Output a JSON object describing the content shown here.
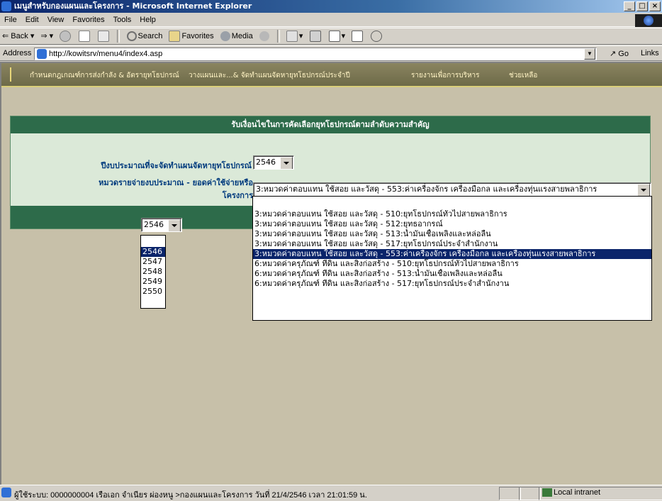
{
  "window": {
    "title": "เมนูสำหรับกองแผนและโครงการ - Microsoft Internet Explorer",
    "min": "_",
    "max": "□",
    "close": "×"
  },
  "menu": [
    "File",
    "Edit",
    "View",
    "Favorites",
    "Tools",
    "Help"
  ],
  "toolbar": {
    "back": "Back",
    "search": "Search",
    "favorites": "Favorites",
    "media": "Media"
  },
  "address": {
    "label": "Address",
    "url": "http://kowitsrv/menu4/index4.asp",
    "go": "Go",
    "links": "Links"
  },
  "nav": [
    "กำหนดกฎเกณฑ์การส่งกำลัง & อัตรายุทโธปกรณ์",
    "วางแผนและ...& จัดทำแผนจัดหายุทโธปกรณ์ประจำปี",
    "รายงานเพื่อการบริหาร",
    "ช่วยเหลือ"
  ],
  "form": {
    "heading": "รับเงื่อนไขในการคัดเลือกยุทโธปกรณ์ตามลำดับความสำคัญ",
    "year_label": "ปีงบประมาณที่จะจัดทำแผนจัดหายุทโธปกรณ์",
    "year_value": "2546",
    "category_label_1": "หมวดรายจ่ายงบประมาณ - ยอดค่าใช้จ่ายหรือ",
    "category_label_2": "โครงการ",
    "category_value": "3:หมวดค่าตอบแทน ใช้สอย และวัสดุ - 553:ค่าเครื่องจักร เครื่องมือกล และเครื่องทุ่นแรงสายพลาธิการ",
    "category_options": [
      "3:หมวดค่าตอบแทน ใช้สอย และวัสดุ - 510:ยุทโธปกรณ์ทั่วไปสายพลาธิการ",
      "3:หมวดค่าตอบแทน ใช้สอย และวัสดุ - 512:ยุทธอากรณ์",
      "3:หมวดค่าตอบแทน ใช้สอย และวัสดุ - 513:น้ำมันเชื้อเพลิงและหล่อลื่น",
      "3:หมวดค่าตอบแทน ใช้สอย และวัสดุ - 517:ยุทโธปกรณ์ประจำสำนักงาน",
      "3:หมวดค่าตอบแทน ใช้สอย และวัสดุ - 553:ค่าเครื่องจักร เครื่องมือกล และเครื่องทุ่นแรงสายพลาธิการ",
      "6:หมวดค่าครุภัณฑ์ ที่ดิน และสิ่งก่อสร้าง - 510:ยุทโธปกรณ์ทั่วไปสายพลาธิการ",
      "6:หมวดค่าครุภัณฑ์ ที่ดิน และสิ่งก่อสร้าง - 513:น้ำมันเชื้อเพลิงและหล่อลื่น",
      "6:หมวดค่าครุภัณฑ์ ที่ดิน และสิ่งก่อสร้าง - 517:ยุทโธปกรณ์ประจำสำนักงาน"
    ],
    "second_year_value": "2546",
    "second_year_options": [
      "",
      "2546",
      "2547",
      "2548",
      "2549",
      "2550"
    ]
  },
  "status": {
    "text": "ผู้ใช้ระบบ: 0000000004 เรือเอก จำเนียร ผ่องหนู >กองแผนและโครงการ วันที่ 21/4/2546 เวลา 21:01:59 น.",
    "zone": "Local intranet"
  }
}
